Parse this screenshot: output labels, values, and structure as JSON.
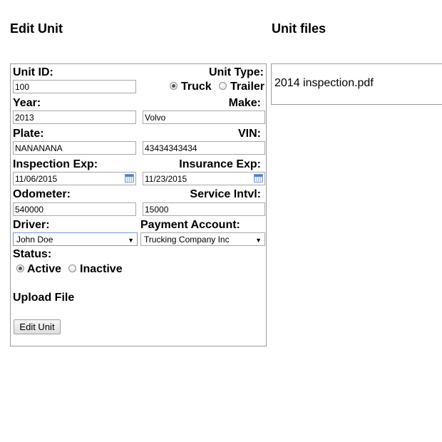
{
  "headings": {
    "edit_unit": "Edit Unit",
    "unit_files": "Unit files"
  },
  "form": {
    "unit_id": {
      "label": "Unit ID:",
      "value": "100"
    },
    "unit_type": {
      "label": "Unit Type:",
      "options": [
        "Truck",
        "Trailer"
      ],
      "selected": "Truck"
    },
    "year": {
      "label": "Year:",
      "value": "2013"
    },
    "make": {
      "label": "Make:",
      "value": "Volvo"
    },
    "plate": {
      "label": "Plate:",
      "value": "NANANANA"
    },
    "vin": {
      "label": "VIN:",
      "value": "43434343434"
    },
    "inspection_exp": {
      "label": "Inspection Exp:",
      "value": "11/06/2015"
    },
    "insurance_exp": {
      "label": "Insurance Exp:",
      "value": "11/23/2015"
    },
    "odometer": {
      "label": "Odometer:",
      "value": "540000"
    },
    "service_intvl": {
      "label": "Service Intvl:",
      "value": "15000"
    },
    "driver": {
      "label": "Driver:",
      "value": "John Doe"
    },
    "payment_account": {
      "label": "Payment Account:",
      "value": "Trucking Company Inc"
    },
    "status": {
      "label": "Status:",
      "options": [
        "Active",
        "Inactive"
      ],
      "selected": "Active"
    },
    "upload": {
      "label": "Upload File"
    },
    "submit_label": "Edit Unit"
  },
  "files": [
    "2014 inspection.pdf"
  ],
  "icons": {
    "date_picker": "calendar-icon",
    "select_arrow": "chevron-down-icon"
  }
}
